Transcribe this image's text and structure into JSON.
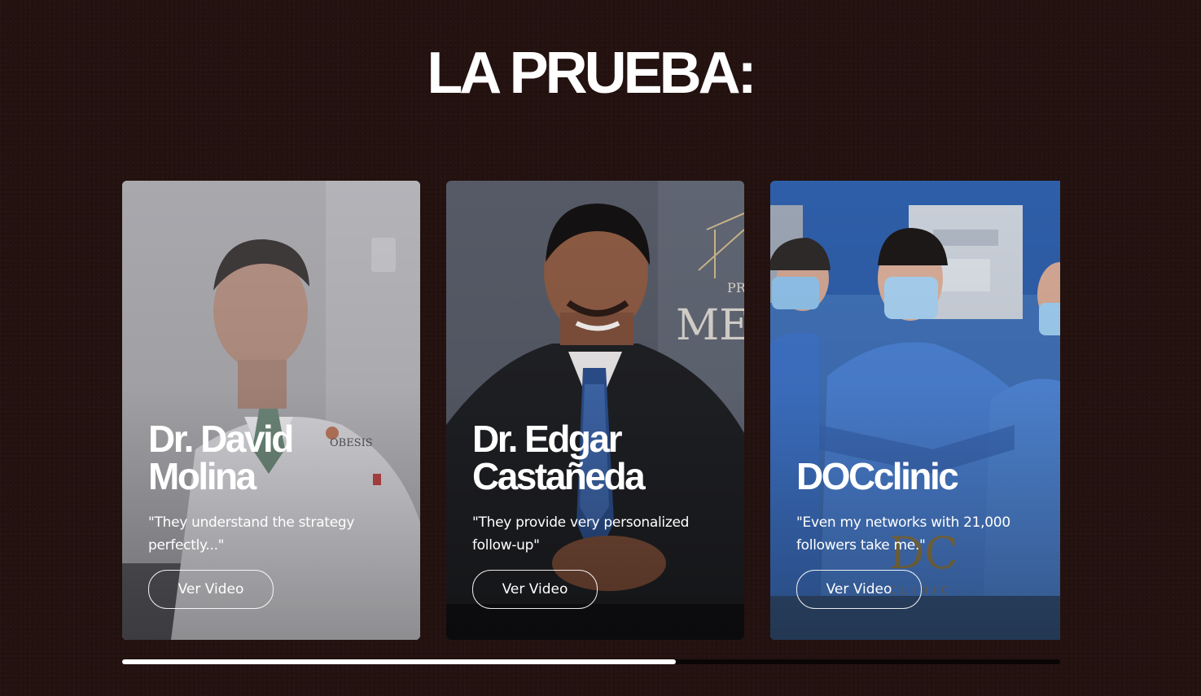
{
  "section": {
    "title": "LA PRUEBA:"
  },
  "testimonials": [
    {
      "name": "Dr. David Molina",
      "quote": "\"They understand the strategy perfectly...\"",
      "button_label": "Ver Video",
      "logo_text": "OBESIS"
    },
    {
      "name": "Dr. Edgar Castañeda",
      "quote": "\"They provide very personalized follow-up\"",
      "button_label": "Ver Video",
      "logo_text": "ME"
    },
    {
      "name": "DOCclinic",
      "quote": "\"Even my networks with 21,000 followers take me.\"",
      "button_label": "Ver Video",
      "logo_text": "DC"
    }
  ],
  "carousel": {
    "progress_fraction": 0.59
  },
  "colors": {
    "background": "#241210",
    "text": "#ffffff",
    "progress_track": "#0a0606",
    "progress_fill": "#ffffff"
  }
}
